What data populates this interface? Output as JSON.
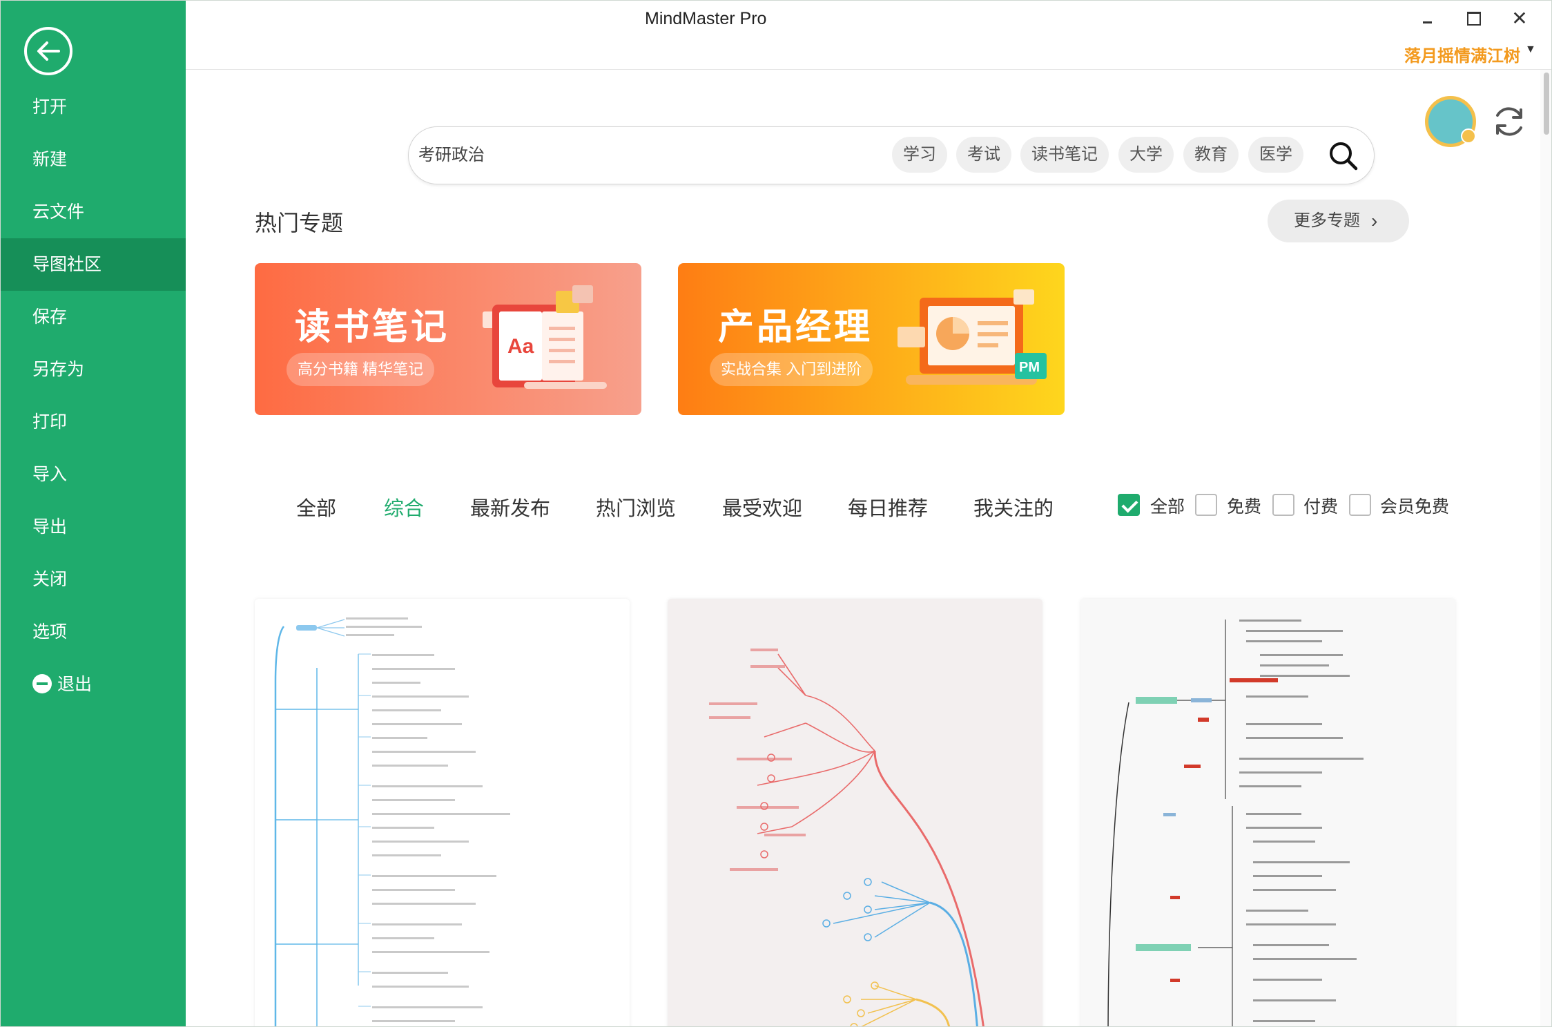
{
  "app": {
    "title": "MindMaster Pro",
    "user_name": "落月摇情满江树"
  },
  "sidebar": {
    "items": [
      {
        "label": "打开"
      },
      {
        "label": "新建"
      },
      {
        "label": "云文件"
      },
      {
        "label": "导图社区",
        "active": true
      },
      {
        "label": "保存"
      },
      {
        "label": "另存为"
      },
      {
        "label": "打印"
      },
      {
        "label": "导入"
      },
      {
        "label": "导出"
      },
      {
        "label": "关闭"
      },
      {
        "label": "选项"
      },
      {
        "label": "退出",
        "icon": "minus-circle-icon"
      }
    ],
    "color": "#1fab6d",
    "active_color": "#168f58"
  },
  "search": {
    "placeholder": "考研政治",
    "tags": [
      "学习",
      "考试",
      "读书笔记",
      "大学",
      "教育",
      "医学"
    ]
  },
  "hot_topics": {
    "title": "热门专题",
    "more_label": "更多专题",
    "banners": [
      {
        "title": "读书笔记",
        "subtitle": "高分书籍 精华笔记",
        "badge": "Aa"
      },
      {
        "title": "产品经理",
        "subtitle": "实战合集 入门到进阶",
        "badge": "PM"
      }
    ]
  },
  "filters": {
    "tabs": [
      "全部",
      "综合",
      "最新发布",
      "热门浏览",
      "最受欢迎",
      "每日推荐",
      "我关注的"
    ],
    "active_tab": "综合",
    "price": [
      {
        "label": "全部",
        "checked": true
      },
      {
        "label": "免费",
        "checked": false
      },
      {
        "label": "付费",
        "checked": false
      },
      {
        "label": "会员免费",
        "checked": false
      }
    ]
  },
  "cards": [
    {
      "name": "mindmap-thumbnail-blue"
    },
    {
      "name": "mindmap-thumbnail-red"
    },
    {
      "name": "mindmap-thumbnail-dark"
    }
  ],
  "colors": {
    "accent": "#1fab6d",
    "user": "#f39a1e"
  }
}
